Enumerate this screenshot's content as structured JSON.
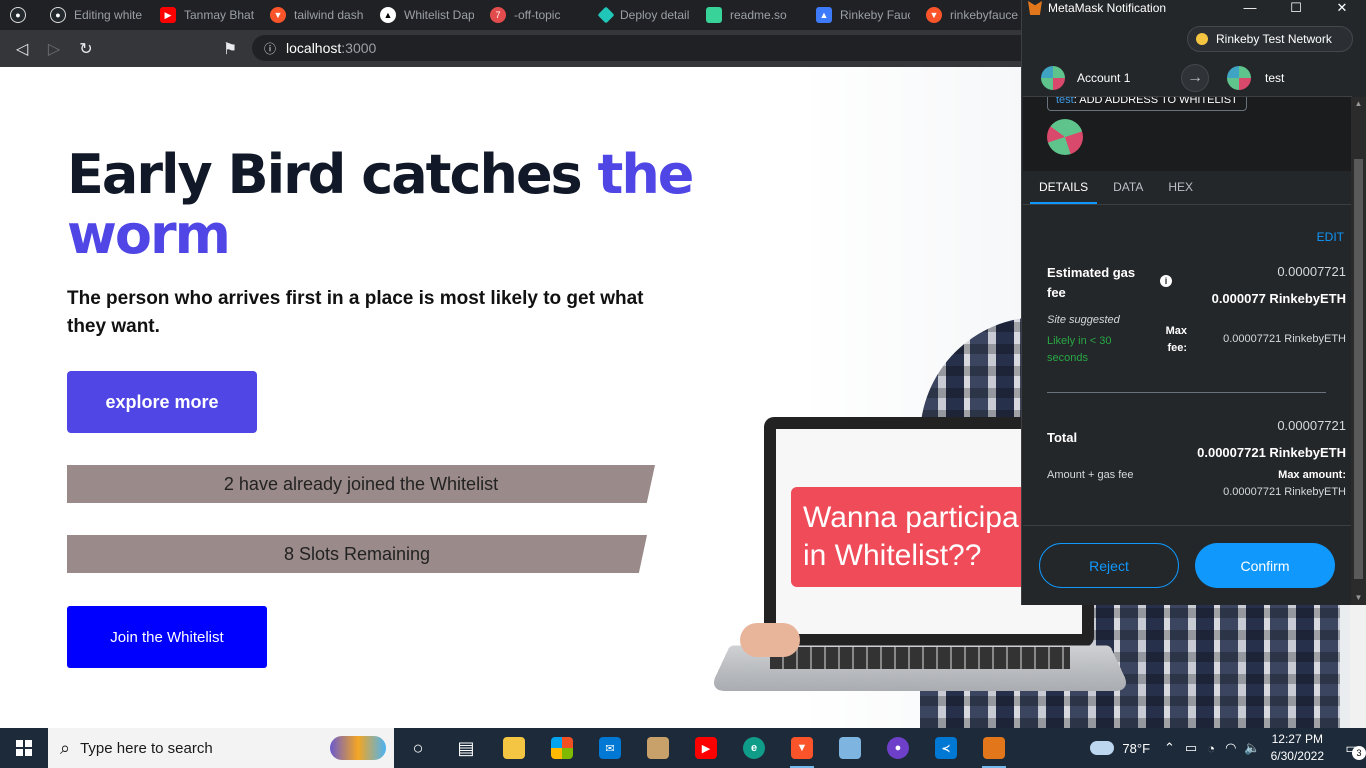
{
  "browser": {
    "tabs": [
      {
        "label": "",
        "icon": "github-icon",
        "color": "#24292e"
      },
      {
        "label": "Editing white",
        "icon": "github-icon",
        "color": "#24292e"
      },
      {
        "label": "Tanmay Bhat",
        "icon": "youtube-icon",
        "color": "#ff0000"
      },
      {
        "label": "tailwind dash",
        "icon": "brave-icon",
        "color": "#fb542b"
      },
      {
        "label": "Whitelist Dap",
        "icon": "vercel-icon",
        "color": "#000000"
      },
      {
        "label": "-off-topic",
        "icon": "discord-icon",
        "color": "#e34c4c"
      },
      {
        "label": "Deploy detail",
        "icon": "netlify-icon",
        "color": "#20c6b7"
      },
      {
        "label": "readme.so",
        "icon": "readme-icon",
        "color": "#37d399"
      },
      {
        "label": "Rinkeby Fauc",
        "icon": "faucet-icon",
        "color": "#3e7bfa"
      },
      {
        "label": "rinkebyfauce",
        "icon": "brave-icon",
        "color": "#fb542b"
      }
    ],
    "url_host": "localhost",
    "url_port": ":3000"
  },
  "page": {
    "title_main": "Early Bird catches ",
    "title_accent": "the worm",
    "subtitle": "The person who arrives first in a place is most likely to get what they want.",
    "explore_label": "explore more",
    "joined_text": "2 have already joined the Whitelist",
    "slots_text": "8 Slots Remaining",
    "join_label": "Join the Whitelist",
    "promo_text": "Wanna participa\nin Whitelist??"
  },
  "metamask": {
    "window_title": "MetaMask Notification",
    "network": "Rinkeby Test Network",
    "from_account": "Account 1",
    "to_account": "test",
    "origin_site": "test",
    "origin_action": ": ADD ADDRESS TO WHITELIST",
    "tabs": [
      "DETAILS",
      "DATA",
      "HEX"
    ],
    "edit_label": "EDIT",
    "gas_label": "Estimated gas fee",
    "gas_value": "0.00007721",
    "gas_value_eth": "0.000077 RinkebyETH",
    "site_suggested": "Site suggested",
    "likely_time": "Likely in < 30 seconds",
    "max_fee_label": "Max fee:",
    "max_fee_value": "0.00007721 RinkebyETH",
    "total_label": "Total",
    "total_value": "0.00007721",
    "total_value_eth": "0.00007721 RinkebyETH",
    "amount_gas_label": "Amount + gas fee",
    "max_amount_label": "Max amount:",
    "max_amount_value": "0.00007721 RinkebyETH",
    "reject_label": "Reject",
    "confirm_label": "Confirm",
    "accent_color": "#1098fc",
    "success_color": "#28a745"
  },
  "taskbar": {
    "search_placeholder": "Type here to search",
    "apps": [
      "task-view",
      "file-explorer",
      "microsoft-store",
      "mail",
      "package",
      "youtube",
      "edge",
      "brave",
      "notepad",
      "github-desktop",
      "vscode",
      "metamask"
    ],
    "weather": "78°F",
    "time": "12:27 PM",
    "date": "6/30/2022",
    "notification_count": "3"
  }
}
